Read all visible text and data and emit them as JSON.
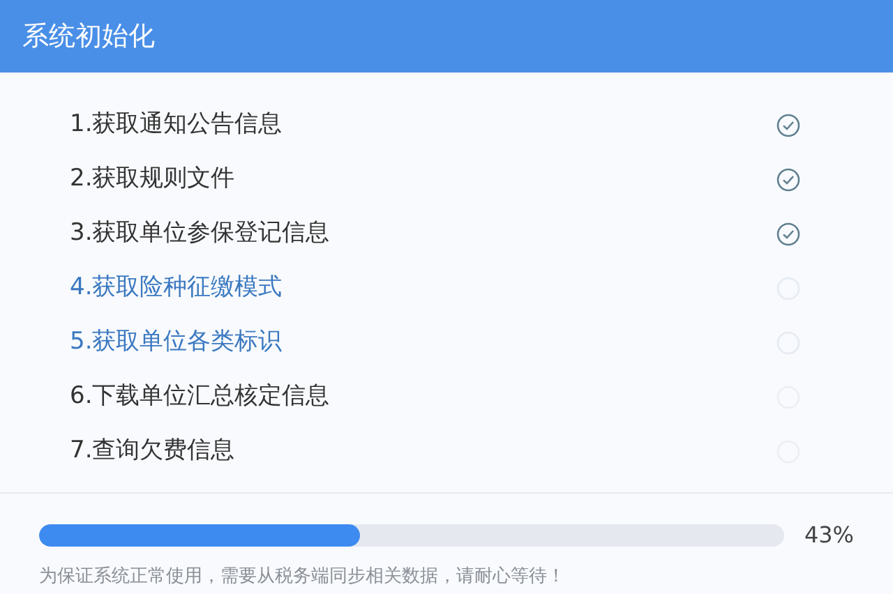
{
  "window": {
    "title": "系统初始化"
  },
  "steps": [
    {
      "label": "1.获取通知公告信息",
      "kind": "done"
    },
    {
      "label": "2.获取规则文件",
      "kind": "done"
    },
    {
      "label": "3.获取单位参保登记信息",
      "kind": "done"
    },
    {
      "label": "4.获取险种征缴模式",
      "kind": "active"
    },
    {
      "label": "5.获取单位各类标识",
      "kind": "active"
    },
    {
      "label": "6.下载单位汇总核定信息",
      "kind": "pending"
    },
    {
      "label": "7.查询欠费信息",
      "kind": "pending"
    }
  ],
  "progress": {
    "level": 0.43,
    "reading": "43%"
  },
  "note": "为保证系统正常使用，需要从税务端同步相关数据，请耐心等待！"
}
